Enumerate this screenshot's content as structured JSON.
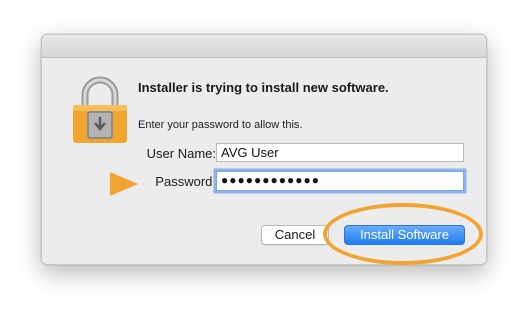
{
  "dialog": {
    "heading": "Installer is trying to install new software.",
    "subtext": "Enter your password to allow this.",
    "username_label": "User Name:",
    "username_value": "AVG User",
    "password_label": "Password:",
    "password_value": "●●●●●●●●●●●●",
    "cancel_label": "Cancel",
    "install_label": "Install Software"
  },
  "icons": {
    "lock": "lock-installer-icon",
    "arrow": "arrow-right-icon"
  },
  "colors": {
    "accent_orange": "#f2a432",
    "primary_button": "#1e7ef1",
    "focus_ring": "#8cb4ec"
  }
}
